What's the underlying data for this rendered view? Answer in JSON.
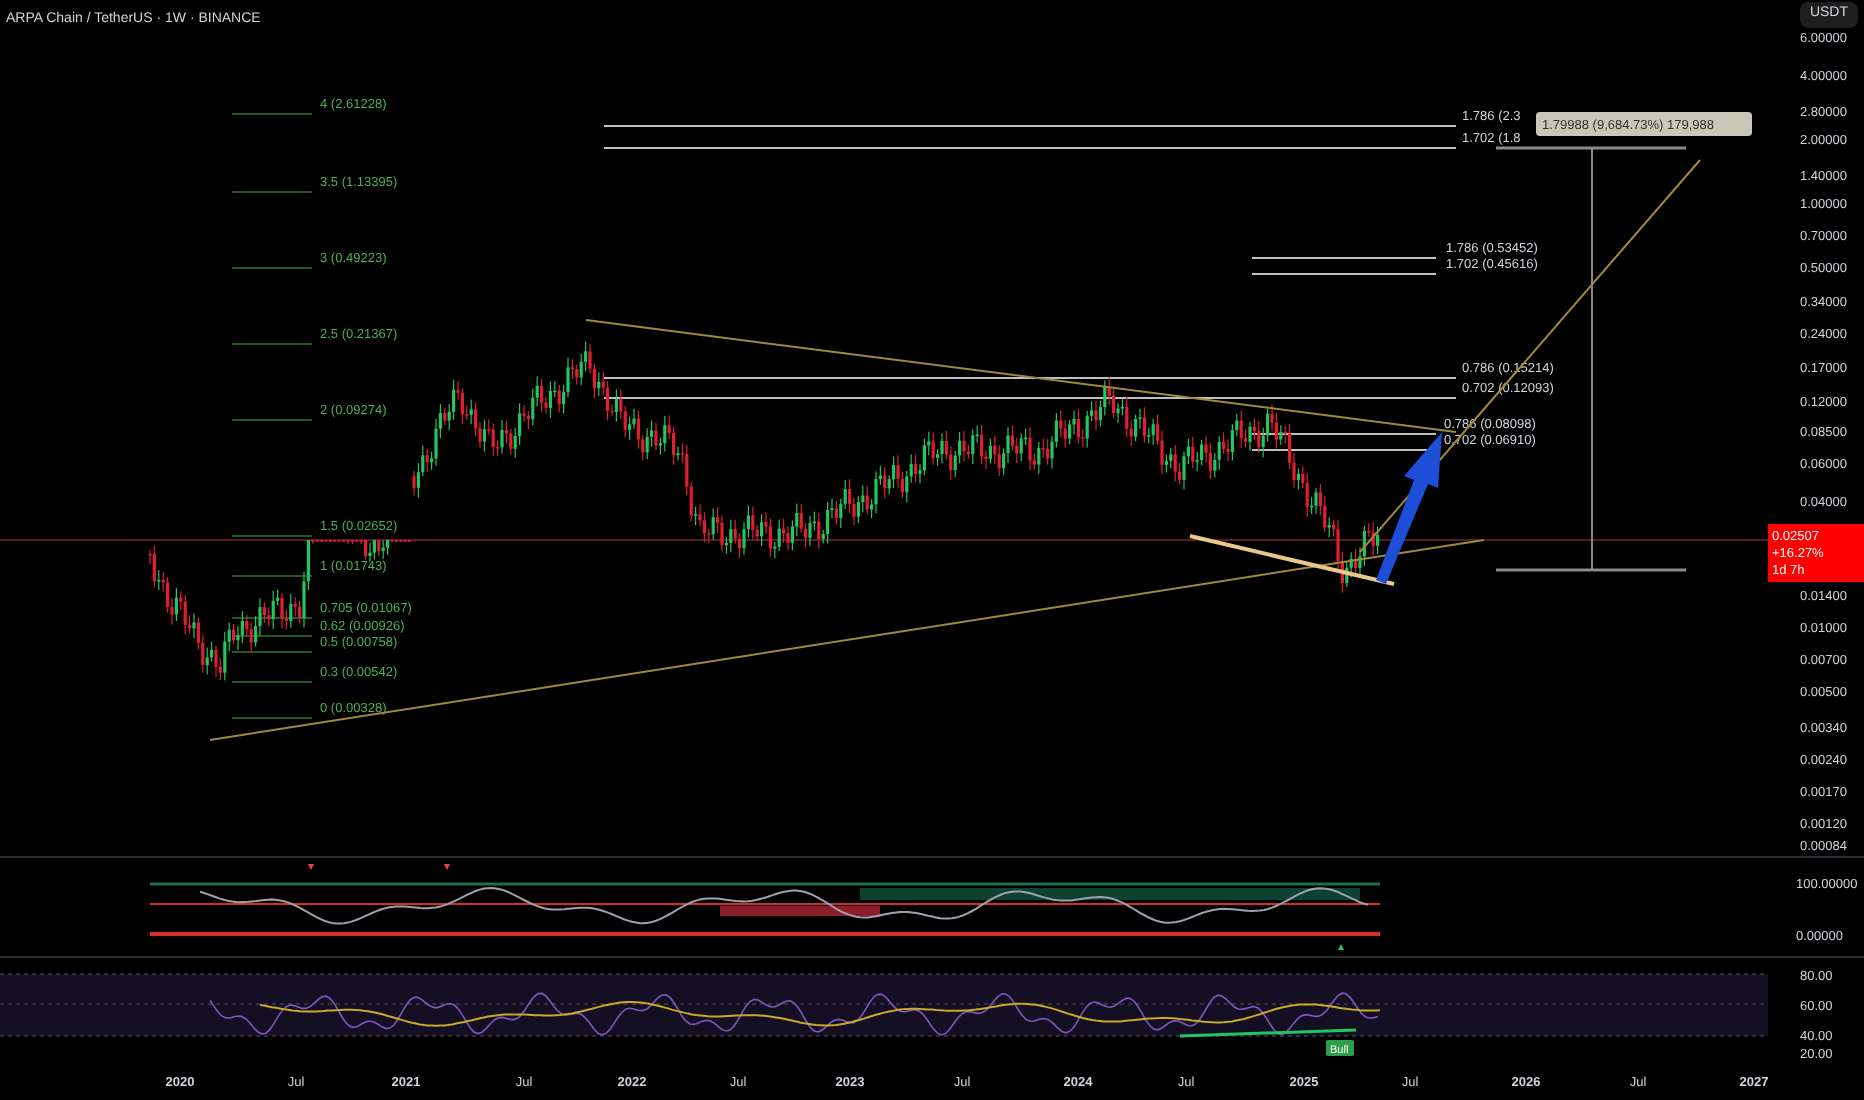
{
  "header": {
    "title": "ARPA Chain / TetherUS · 1W · BINANCE",
    "currency": "USDT"
  },
  "price_axis": [
    "6.00000",
    "4.00000",
    "2.80000",
    "2.00000",
    "1.40000",
    "1.00000",
    "0.70000",
    "0.50000",
    "0.34000",
    "0.24000",
    "0.17000",
    "0.12000",
    "0.08500",
    "0.06000",
    "0.04000",
    "0.01400",
    "0.01000",
    "0.00700",
    "0.00500",
    "0.00340",
    "0.00240",
    "0.00170",
    "0.00120",
    "0.00084"
  ],
  "price_tag": {
    "price": "0.02507",
    "change": "+16.27%",
    "countdown": "1d 7h"
  },
  "fib_left": [
    "4 (2.61228)",
    "3.5 (1.13395)",
    "3 (0.49223)",
    "2.5 (0.21367)",
    "2 (0.09274)",
    "1.5 (0.02652)",
    "1 (0.01743)",
    "0.705 (0.01067)",
    "0.62 (0.00926)",
    "0.5 (0.00758)",
    "0.3 (0.00542)",
    "0 (0.00328)"
  ],
  "fib_right": [
    "1.786 (2.3",
    "1.702 (1.8",
    "1.786 (0.53452)",
    "1.702 (0.45616)",
    "0.786 (0.15214)",
    "0.702 (0.12093)",
    "0.786 (0.08098)",
    "0.702 (0.06910)"
  ],
  "measure": {
    "label": "1.79988 (9,684.73%) 179,988"
  },
  "oscillator_axis": [
    "100.00000",
    "0.00000"
  ],
  "rsi_axis": [
    "80.00",
    "60.00",
    "40.00",
    "20.00"
  ],
  "rsi": {
    "signal_label": "Bull"
  },
  "time_axis": [
    "2020",
    "Jul",
    "2021",
    "Jul",
    "2022",
    "Jul",
    "2023",
    "Jul",
    "2024",
    "Jul",
    "2025",
    "Jul",
    "2026",
    "Jul",
    "2027"
  ]
}
